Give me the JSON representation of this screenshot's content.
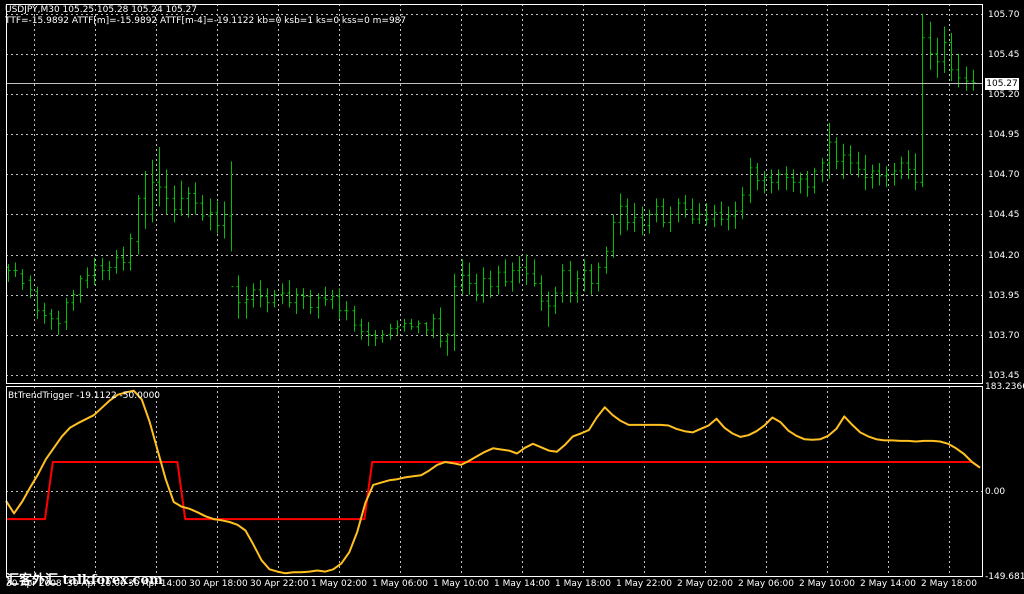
{
  "header": {
    "symbol_line": "USDJPY,M30  105.25 105.28 105.24 105.27",
    "indicator_line": "TTF=-15.9892 ATTF[m]=-15.9892 ATTF[m-4]=-19.1122 kb=0 ksb=1 ks=0 kss=0 m=987"
  },
  "price_axis": {
    "ticks": [
      "105.70",
      "105.45",
      "105.20",
      "104.95",
      "104.70",
      "104.45",
      "104.20",
      "103.95",
      "103.70",
      "103.45"
    ],
    "current_price": "105.27"
  },
  "indicator": {
    "title": "BtTrendTrigger -19.1122 -50.0000",
    "ticks": [
      "183.2366",
      "0.00",
      "-149.6812"
    ]
  },
  "time_axis": {
    "labels": [
      "30 Apr 2008",
      "30 Apr 10:00",
      "30 Apr 14:00",
      "30 Apr 18:00",
      "30 Apr 22:00",
      "1 May 02:00",
      "1 May 06:00",
      "1 May 10:00",
      "1 May 14:00",
      "1 May 18:00",
      "1 May 22:00",
      "2 May 02:00",
      "2 May 06:00",
      "2 May 10:00",
      "2 May 14:00",
      "2 May 18:00"
    ]
  },
  "watermark": "汇客外汇 talkforex.com",
  "colors": {
    "background": "#000000",
    "grid": "#c0c0c0",
    "bars": "#00c000",
    "trend_line": "#ffc020",
    "trigger_line": "#ff0000",
    "text": "#ffffff"
  },
  "chart_data": [
    {
      "type": "bar",
      "title": "USDJPY,M30",
      "ylim": [
        103.4,
        105.76
      ],
      "ohlc": [
        [
          104.12,
          104.14,
          104.03,
          104.1
        ],
        [
          104.1,
          104.15,
          104.06,
          104.1
        ],
        [
          104.08,
          104.11,
          103.98,
          104.02
        ],
        [
          104.04,
          104.07,
          103.93,
          103.98
        ],
        [
          103.97,
          104.0,
          103.8,
          103.85
        ],
        [
          103.85,
          103.9,
          103.77,
          103.82
        ],
        [
          103.83,
          103.86,
          103.73,
          103.8
        ],
        [
          103.8,
          103.85,
          103.7,
          103.77
        ],
        [
          103.78,
          103.93,
          103.73,
          103.9
        ],
        [
          103.9,
          103.98,
          103.85,
          103.95
        ],
        [
          103.95,
          104.07,
          103.9,
          104.05
        ],
        [
          104.04,
          104.12,
          103.99,
          104.07
        ],
        [
          104.07,
          104.18,
          104.01,
          104.13
        ],
        [
          104.13,
          104.18,
          104.04,
          104.1
        ],
        [
          104.1,
          104.16,
          104.04,
          104.12
        ],
        [
          104.12,
          104.23,
          104.08,
          104.18
        ],
        [
          104.18,
          104.25,
          104.1,
          104.15
        ],
        [
          104.15,
          104.33,
          104.1,
          104.3
        ],
        [
          104.28,
          104.57,
          104.2,
          104.55
        ],
        [
          104.55,
          104.72,
          104.36,
          104.45
        ],
        [
          104.45,
          104.79,
          104.4,
          104.65
        ],
        [
          104.65,
          104.87,
          104.5,
          104.62
        ],
        [
          104.62,
          104.73,
          104.45,
          104.55
        ],
        [
          104.55,
          104.63,
          104.4,
          104.48
        ],
        [
          104.48,
          104.66,
          104.44,
          104.55
        ],
        [
          104.55,
          104.62,
          104.43,
          104.58
        ],
        [
          104.58,
          104.65,
          104.45,
          104.52
        ],
        [
          104.52,
          104.57,
          104.41,
          104.44
        ],
        [
          104.44,
          104.55,
          104.35,
          104.46
        ],
        [
          104.46,
          104.53,
          104.33,
          104.38
        ],
        [
          104.38,
          104.53,
          104.3,
          104.45
        ],
        [
          104.44,
          104.78,
          104.22,
          104.0
        ],
        [
          104.0,
          104.07,
          103.8,
          103.9
        ],
        [
          103.9,
          104.0,
          103.8,
          103.92
        ],
        [
          103.92,
          104.02,
          103.87,
          103.98
        ],
        [
          103.98,
          104.04,
          103.87,
          103.94
        ],
        [
          103.94,
          103.99,
          103.84,
          103.9
        ],
        [
          103.9,
          103.98,
          103.87,
          103.95
        ],
        [
          103.95,
          104.02,
          103.89,
          103.96
        ],
        [
          103.96,
          104.04,
          103.87,
          103.9
        ],
        [
          103.9,
          103.99,
          103.83,
          103.95
        ],
        [
          103.95,
          103.99,
          103.86,
          103.94
        ],
        [
          103.94,
          103.98,
          103.83,
          103.87
        ],
        [
          103.87,
          103.96,
          103.8,
          103.93
        ],
        [
          103.93,
          104.0,
          103.88,
          103.92
        ],
        [
          103.92,
          103.98,
          103.86,
          103.94
        ],
        [
          103.94,
          103.99,
          103.8,
          103.85
        ],
        [
          103.85,
          103.91,
          103.79,
          103.85
        ],
        [
          103.85,
          103.88,
          103.72,
          103.76
        ],
        [
          103.76,
          103.8,
          103.67,
          103.72
        ],
        [
          103.72,
          103.78,
          103.63,
          103.7
        ],
        [
          103.7,
          103.73,
          103.63,
          103.68
        ],
        [
          103.68,
          103.73,
          103.65,
          103.7
        ],
        [
          103.7,
          103.77,
          103.67,
          103.74
        ],
        [
          103.74,
          103.79,
          103.7,
          103.75
        ],
        [
          103.75,
          103.8,
          103.72,
          103.77
        ],
        [
          103.77,
          103.8,
          103.73,
          103.75
        ],
        [
          103.75,
          103.79,
          103.71,
          103.77
        ],
        [
          103.77,
          103.78,
          103.7,
          103.73
        ],
        [
          103.73,
          103.83,
          103.68,
          103.8
        ],
        [
          103.8,
          103.87,
          103.62,
          103.66
        ],
        [
          103.66,
          103.71,
          103.57,
          103.7
        ],
        [
          103.7,
          104.08,
          103.6,
          104.0
        ],
        [
          104.0,
          104.17,
          103.95,
          104.07
        ],
        [
          104.07,
          104.15,
          103.95,
          104.02
        ],
        [
          104.02,
          104.08,
          103.91,
          103.95
        ],
        [
          103.95,
          104.12,
          103.9,
          104.05
        ],
        [
          104.05,
          104.1,
          103.93,
          104.0
        ],
        [
          104.0,
          104.13,
          103.95,
          104.09
        ],
        [
          104.09,
          104.17,
          104.0,
          104.03
        ],
        [
          104.03,
          104.15,
          103.97,
          104.1
        ],
        [
          104.1,
          104.19,
          104.02,
          104.12
        ],
        [
          104.12,
          104.2,
          104.01,
          104.08
        ],
        [
          104.08,
          104.17,
          104.0,
          104.02
        ],
        [
          104.02,
          104.07,
          103.85,
          103.91
        ],
        [
          103.91,
          103.97,
          103.75,
          103.88
        ],
        [
          103.88,
          104.0,
          103.83,
          103.96
        ],
        [
          103.96,
          104.14,
          103.9,
          104.1
        ],
        [
          104.1,
          104.16,
          103.9,
          103.96
        ],
        [
          103.96,
          104.1,
          103.9,
          104.05
        ],
        [
          104.05,
          104.17,
          103.97,
          104.1
        ],
        [
          104.1,
          104.14,
          103.95,
          104.02
        ],
        [
          104.02,
          104.15,
          103.97,
          104.12
        ],
        [
          104.12,
          104.25,
          104.08,
          104.22
        ],
        [
          104.22,
          104.45,
          104.18,
          104.4
        ],
        [
          104.4,
          104.58,
          104.32,
          104.5
        ],
        [
          104.5,
          104.55,
          104.35,
          104.4
        ],
        [
          104.4,
          104.52,
          104.34,
          104.43
        ],
        [
          104.43,
          104.5,
          104.32,
          104.38
        ],
        [
          104.38,
          104.48,
          104.33,
          104.45
        ],
        [
          104.45,
          104.55,
          104.4,
          104.5
        ],
        [
          104.5,
          104.55,
          104.37,
          104.4
        ],
        [
          104.4,
          104.5,
          104.34,
          104.45
        ],
        [
          104.45,
          104.55,
          104.4,
          104.52
        ],
        [
          104.52,
          104.57,
          104.43,
          104.48
        ],
        [
          104.48,
          104.55,
          104.39,
          104.42
        ],
        [
          104.42,
          104.52,
          104.39,
          104.45
        ],
        [
          104.45,
          104.52,
          104.38,
          104.42
        ],
        [
          104.42,
          104.51,
          104.37,
          104.46
        ],
        [
          104.46,
          104.53,
          104.38,
          104.42
        ],
        [
          104.42,
          104.5,
          104.35,
          104.44
        ],
        [
          104.44,
          104.53,
          104.36,
          104.47
        ],
        [
          104.47,
          104.62,
          104.42,
          104.57
        ],
        [
          104.57,
          104.8,
          104.52,
          104.74
        ],
        [
          104.74,
          104.77,
          104.6,
          104.66
        ],
        [
          104.66,
          104.72,
          104.58,
          104.68
        ],
        [
          104.68,
          104.73,
          104.58,
          104.65
        ],
        [
          104.65,
          104.73,
          104.6,
          104.7
        ],
        [
          104.7,
          104.75,
          104.6,
          104.68
        ],
        [
          104.68,
          104.73,
          104.59,
          104.65
        ],
        [
          104.65,
          104.71,
          104.58,
          104.67
        ],
        [
          104.67,
          104.72,
          104.56,
          104.62
        ],
        [
          104.62,
          104.74,
          104.58,
          104.72
        ],
        [
          104.72,
          104.8,
          104.65,
          104.77
        ],
        [
          104.77,
          105.02,
          104.67,
          104.9
        ],
        [
          104.9,
          104.93,
          104.73,
          104.78
        ],
        [
          104.78,
          104.89,
          104.67,
          104.82
        ],
        [
          104.82,
          104.88,
          104.7,
          104.77
        ],
        [
          104.77,
          104.84,
          104.68,
          104.73
        ],
        [
          104.73,
          104.82,
          104.6,
          104.68
        ],
        [
          104.68,
          104.76,
          104.61,
          104.72
        ],
        [
          104.72,
          104.77,
          104.63,
          104.69
        ],
        [
          104.69,
          104.75,
          104.62,
          104.7
        ],
        [
          104.7,
          104.77,
          104.63,
          104.72
        ],
        [
          104.72,
          104.81,
          104.67,
          104.77
        ],
        [
          104.77,
          104.85,
          104.67,
          104.73
        ],
        [
          104.73,
          104.83,
          104.6,
          104.65
        ],
        [
          104.65,
          105.7,
          104.62,
          105.55
        ],
        [
          105.55,
          105.65,
          105.35,
          105.45
        ],
        [
          105.45,
          105.55,
          105.3,
          105.4
        ],
        [
          105.4,
          105.62,
          105.33,
          105.52
        ],
        [
          105.52,
          105.58,
          105.28,
          105.35
        ],
        [
          105.35,
          105.45,
          105.24,
          105.3
        ],
        [
          105.3,
          105.37,
          105.22,
          105.28
        ],
        [
          105.28,
          105.35,
          105.22,
          105.27
        ]
      ]
    },
    {
      "type": "line",
      "title": "BtTrendTrigger -19.1122 -50.0000",
      "ylim": [
        -149.6812,
        183.2366
      ],
      "series": [
        {
          "values": [
            -18,
            -40,
            -20,
            5,
            28,
            55,
            75,
            95,
            110,
            118,
            125,
            132,
            145,
            158,
            168,
            172,
            175,
            160,
            120,
            70,
            20,
            -20,
            -28,
            -32,
            -38,
            -45,
            -50,
            -52,
            -55,
            -60,
            -70,
            -95,
            -122,
            -138,
            -142,
            -145,
            -143,
            -143,
            -142,
            -140,
            -142,
            -138,
            -128,
            -108,
            -72,
            -22,
            10,
            14,
            18,
            20,
            23,
            25,
            27,
            35,
            45,
            50,
            48,
            45,
            52,
            60,
            68,
            74,
            72,
            70,
            65,
            75,
            82,
            76,
            70,
            68,
            80,
            95,
            100,
            106,
            128,
            146,
            132,
            122,
            115,
            115,
            115,
            115,
            115,
            114,
            108,
            104,
            102,
            108,
            114,
            126,
            110,
            100,
            94,
            97,
            104,
            114,
            128,
            120,
            105,
            96,
            90,
            89,
            90,
            96,
            108,
            130,
            115,
            102,
            95,
            90,
            88,
            88,
            87,
            87,
            86,
            87,
            87,
            86,
            82,
            74,
            64,
            50,
            40
          ]
        },
        {
          "values": [
            -50,
            -50,
            -50,
            -50,
            -50,
            -50,
            50,
            50,
            50,
            50,
            50,
            50,
            50,
            50,
            50,
            50,
            50,
            50,
            50,
            50,
            50,
            50,
            50,
            -50,
            -50,
            -50,
            -50,
            -50,
            -50,
            -50,
            -50,
            -50,
            -50,
            -50,
            -50,
            -50,
            -50,
            -50,
            -50,
            -50,
            -50,
            -50,
            -50,
            -50,
            -50,
            -50,
            -50,
            50,
            50,
            50,
            50,
            50,
            50,
            50,
            50,
            50,
            50,
            50,
            50,
            50,
            50,
            50,
            50,
            50,
            50,
            50,
            50,
            50,
            50,
            50,
            50,
            50,
            50,
            50,
            50,
            50,
            50,
            50,
            50,
            50,
            50,
            50,
            50,
            50,
            50,
            50,
            50,
            50,
            50,
            50,
            50,
            50,
            50,
            50,
            50,
            50,
            50,
            50,
            50,
            50,
            50,
            50,
            50,
            50,
            50,
            50,
            50,
            50,
            50,
            50,
            50,
            50,
            50,
            50,
            50,
            50,
            50,
            50,
            50,
            50,
            50,
            50,
            50,
            50,
            50,
            40
          ]
        }
      ]
    }
  ]
}
